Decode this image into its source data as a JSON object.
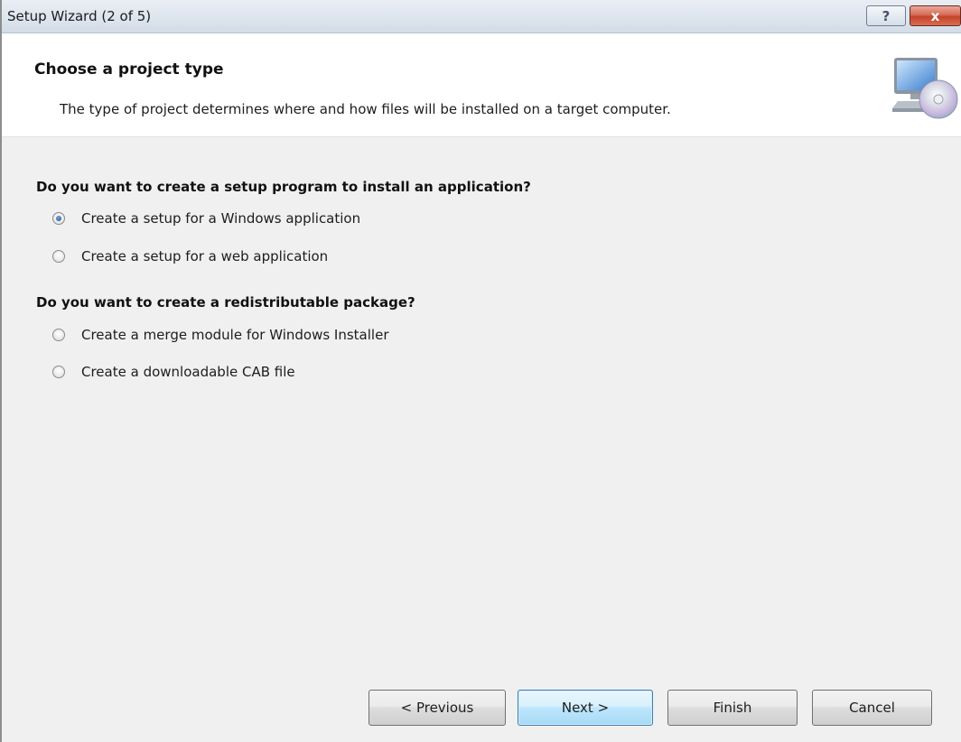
{
  "window": {
    "title": "Setup Wizard (2 of 5)",
    "help_label": "?",
    "close_label": "x"
  },
  "header": {
    "title": "Choose a project type",
    "description": "The type of project determines where and how files will be installed on a target computer.",
    "icon": "computer-disc-icon"
  },
  "group1": {
    "question": "Do you want to create a setup program to install an application?",
    "options": [
      {
        "label": "Create a setup for a Windows application",
        "checked": true
      },
      {
        "label": "Create a setup for a web application",
        "checked": false
      }
    ]
  },
  "group2": {
    "question": "Do you want to create a redistributable package?",
    "options": [
      {
        "label": "Create a merge module for Windows Installer",
        "checked": false
      },
      {
        "label": "Create a downloadable CAB file",
        "checked": false
      }
    ]
  },
  "buttons": {
    "previous": "< Previous",
    "next": "Next >",
    "finish": "Finish",
    "cancel": "Cancel"
  }
}
